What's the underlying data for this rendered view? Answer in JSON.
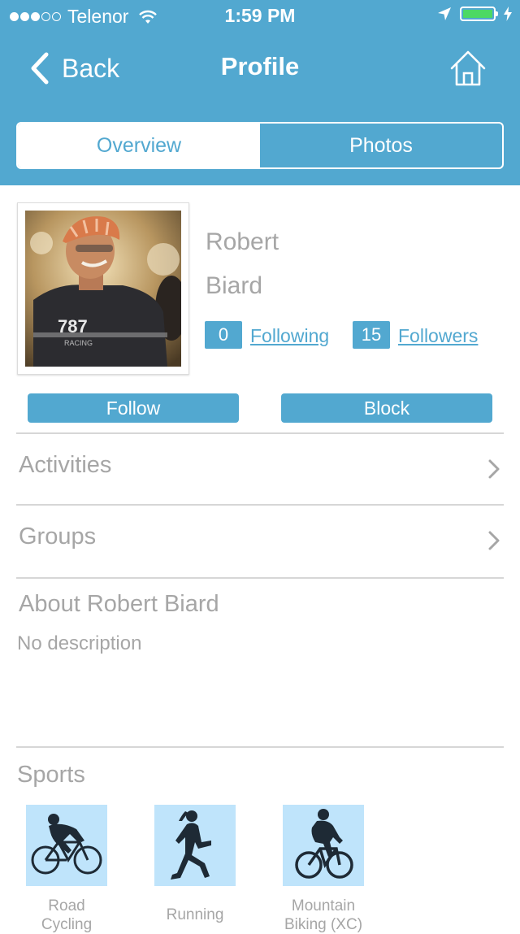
{
  "status_bar": {
    "carrier": "Telenor",
    "time": "1:59 PM"
  },
  "nav": {
    "back_label": "Back",
    "title": "Profile"
  },
  "tabs": [
    {
      "label": "Overview",
      "active": true
    },
    {
      "label": "Photos",
      "active": false
    }
  ],
  "profile": {
    "first_name": "Robert",
    "last_name": "Biard",
    "following_count": "0",
    "following_label": "Following",
    "followers_count": "15",
    "followers_label": "Followers"
  },
  "actions": {
    "follow_label": "Follow",
    "block_label": "Block"
  },
  "menu": [
    {
      "label": "Activities"
    },
    {
      "label": "Groups"
    }
  ],
  "about": {
    "title": "About Robert Biard",
    "description": "No description"
  },
  "sports": {
    "title": "Sports",
    "items": [
      {
        "label_line1": "Road",
        "label_line2": "Cycling",
        "icon": "road-cycling-icon"
      },
      {
        "label_line1": "Running",
        "label_line2": "",
        "icon": "running-icon"
      },
      {
        "label_line1": "Mountain",
        "label_line2": "Biking (XC)",
        "icon": "mountain-biking-icon"
      }
    ]
  },
  "colors": {
    "accent": "#52a8d0",
    "sport_tile": "#bfe4fb",
    "battery": "#4cd964",
    "muted_text": "#a6a6a6"
  }
}
